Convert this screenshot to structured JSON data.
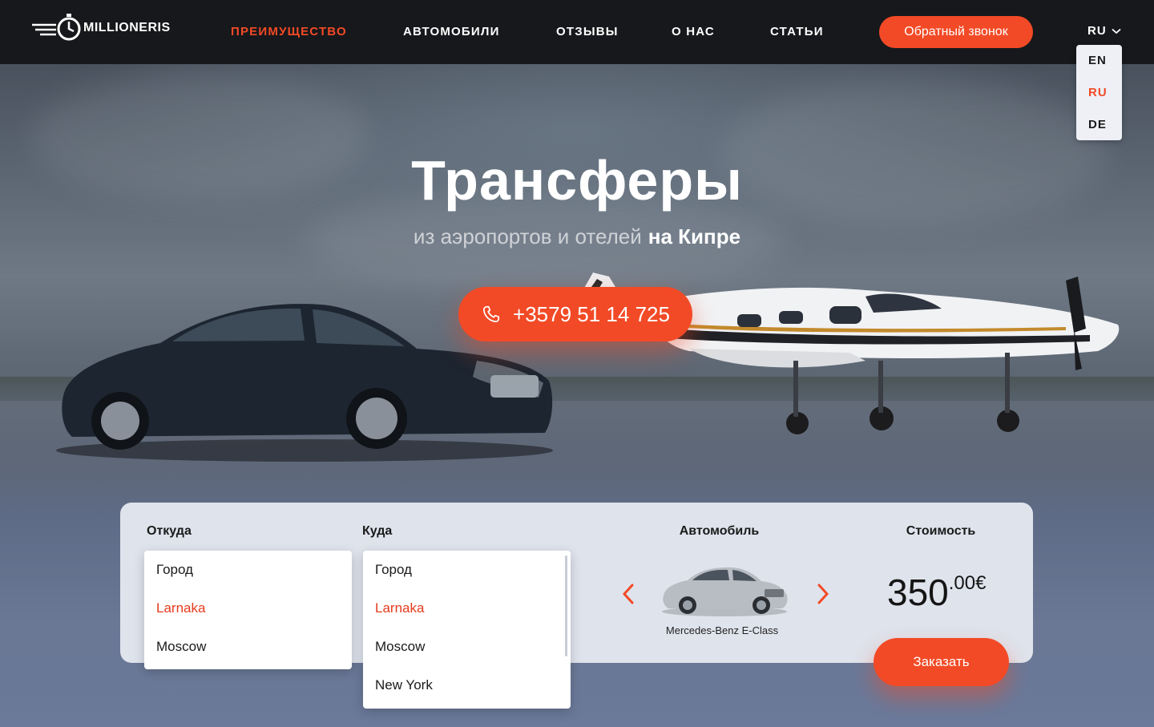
{
  "brand": {
    "name": "MILLIONERIS"
  },
  "nav": {
    "items": [
      {
        "label": "ПРЕИМУЩЕСТВО",
        "active": true
      },
      {
        "label": "АВТОМОБИЛИ",
        "active": false
      },
      {
        "label": "ОТЗЫВЫ",
        "active": false
      },
      {
        "label": "О НАС",
        "active": false
      },
      {
        "label": "СТАТЬИ",
        "active": false
      }
    ],
    "callback_label": "Обратный звонок"
  },
  "language": {
    "current": "RU",
    "options": [
      {
        "label": "EN",
        "active": false
      },
      {
        "label": "RU",
        "active": true
      },
      {
        "label": "DE",
        "active": false
      }
    ]
  },
  "hero": {
    "title": "Трансферы",
    "subtitle": "из аэропортов и отелей",
    "subtitle_strong": "на Кипре",
    "phone": "+3579 51 14 725"
  },
  "booking": {
    "from": {
      "label": "Откуда",
      "options": [
        {
          "label": "Город",
          "active": false
        },
        {
          "label": "Larnaka",
          "active": true
        },
        {
          "label": "Moscow",
          "active": false
        }
      ]
    },
    "to": {
      "label": "Куда",
      "options": [
        {
          "label": "Город",
          "active": false
        },
        {
          "label": "Larnaka",
          "active": true
        },
        {
          "label": "Moscow",
          "active": false
        },
        {
          "label": "New York",
          "active": false
        }
      ]
    },
    "car": {
      "label": "Автомобиль",
      "name": "Mercedes-Benz E-Class"
    },
    "price": {
      "label": "Стоимость",
      "amount": "350",
      "cents": ".00€"
    },
    "order_label": "Заказать"
  },
  "colors": {
    "accent": "#f24a26",
    "navbar": "#17181b",
    "panel": "#dfe3ec"
  },
  "icons": [
    "logo-mark-icon",
    "chevron-down-icon",
    "phone-icon",
    "chevron-left-icon",
    "chevron-right-icon"
  ]
}
